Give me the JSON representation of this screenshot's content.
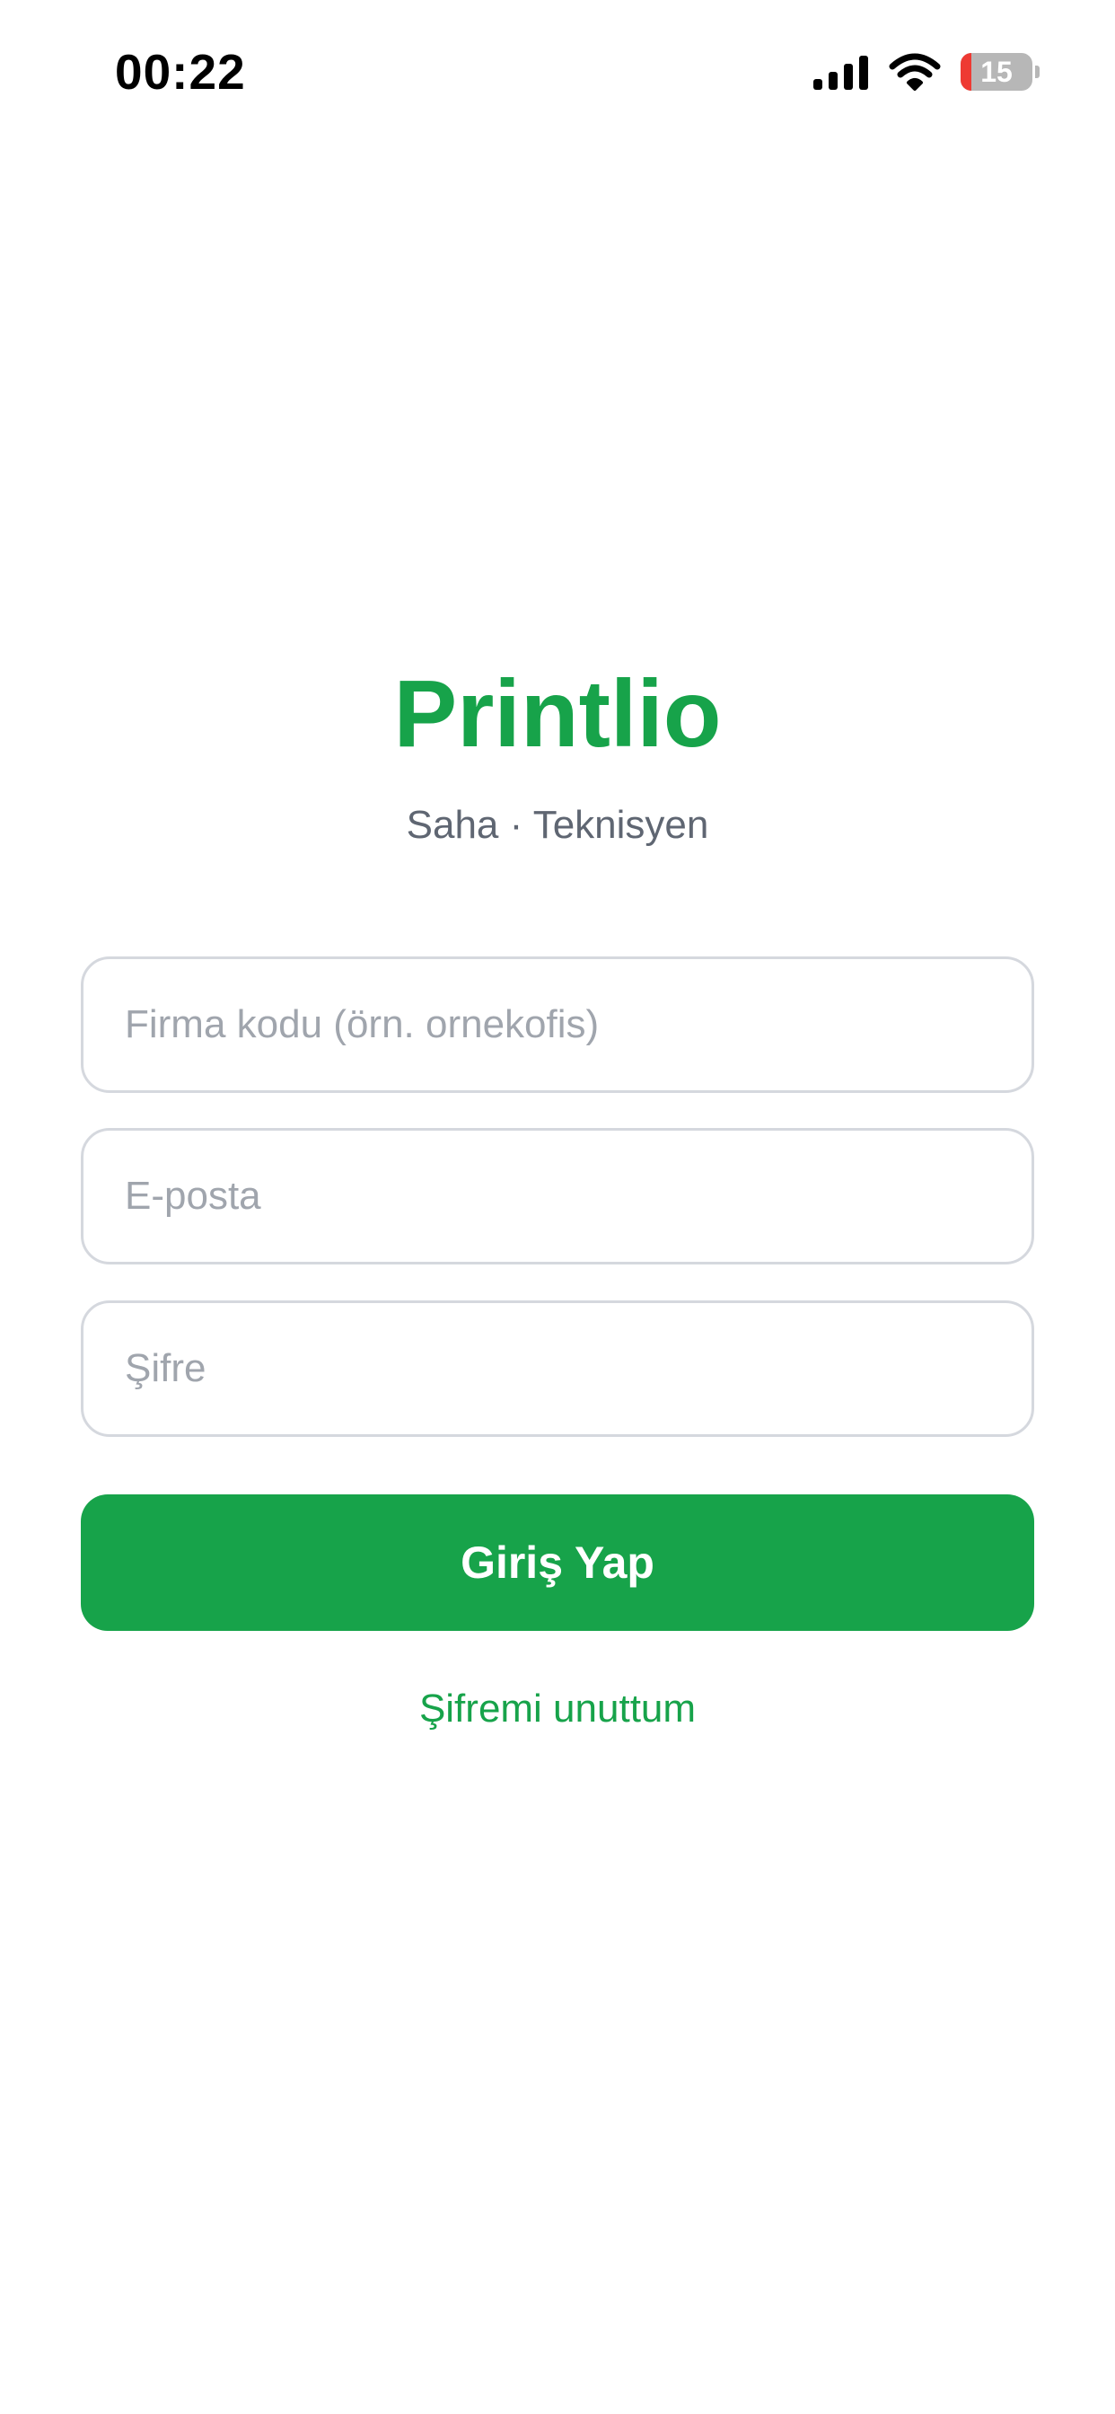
{
  "status_bar": {
    "time": "00:22",
    "battery_level": "15",
    "icons": [
      "signal-icon",
      "wifi-icon",
      "battery-icon"
    ],
    "battery_fill_percent": 15
  },
  "brand": {
    "title": "Printlio",
    "subtitle": "Saha · Teknisyen",
    "color": "#17a34a"
  },
  "form": {
    "company_code": {
      "value": "",
      "placeholder": "Firma kodu (örn. ornekofis)"
    },
    "email": {
      "value": "",
      "placeholder": "E-posta"
    },
    "password": {
      "value": "",
      "placeholder": "Şifre"
    },
    "login_label": "Giriş Yap",
    "forgot_label": "Şifremi unuttum"
  },
  "colors": {
    "accent": "#17a34a",
    "subtitle": "#5f6672",
    "placeholder": "#a0a5ad",
    "field_border": "#d5d8de",
    "battery_low": "#ee3a33"
  }
}
